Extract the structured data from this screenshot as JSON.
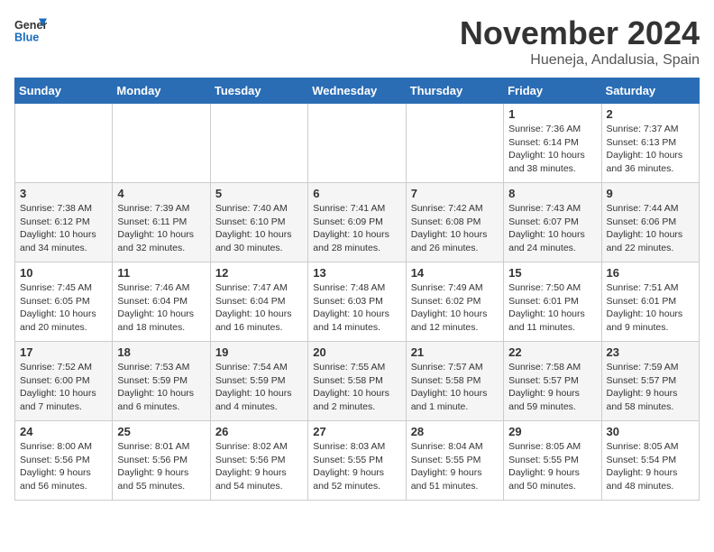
{
  "logo": {
    "line1": "General",
    "line2": "Blue"
  },
  "title": "November 2024",
  "location": "Hueneja, Andalusia, Spain",
  "weekdays": [
    "Sunday",
    "Monday",
    "Tuesday",
    "Wednesday",
    "Thursday",
    "Friday",
    "Saturday"
  ],
  "weeks": [
    [
      null,
      null,
      null,
      null,
      null,
      {
        "day": "1",
        "sunrise": "Sunrise: 7:36 AM",
        "sunset": "Sunset: 6:14 PM",
        "daylight": "Daylight: 10 hours and 38 minutes."
      },
      {
        "day": "2",
        "sunrise": "Sunrise: 7:37 AM",
        "sunset": "Sunset: 6:13 PM",
        "daylight": "Daylight: 10 hours and 36 minutes."
      }
    ],
    [
      {
        "day": "3",
        "sunrise": "Sunrise: 7:38 AM",
        "sunset": "Sunset: 6:12 PM",
        "daylight": "Daylight: 10 hours and 34 minutes."
      },
      {
        "day": "4",
        "sunrise": "Sunrise: 7:39 AM",
        "sunset": "Sunset: 6:11 PM",
        "daylight": "Daylight: 10 hours and 32 minutes."
      },
      {
        "day": "5",
        "sunrise": "Sunrise: 7:40 AM",
        "sunset": "Sunset: 6:10 PM",
        "daylight": "Daylight: 10 hours and 30 minutes."
      },
      {
        "day": "6",
        "sunrise": "Sunrise: 7:41 AM",
        "sunset": "Sunset: 6:09 PM",
        "daylight": "Daylight: 10 hours and 28 minutes."
      },
      {
        "day": "7",
        "sunrise": "Sunrise: 7:42 AM",
        "sunset": "Sunset: 6:08 PM",
        "daylight": "Daylight: 10 hours and 26 minutes."
      },
      {
        "day": "8",
        "sunrise": "Sunrise: 7:43 AM",
        "sunset": "Sunset: 6:07 PM",
        "daylight": "Daylight: 10 hours and 24 minutes."
      },
      {
        "day": "9",
        "sunrise": "Sunrise: 7:44 AM",
        "sunset": "Sunset: 6:06 PM",
        "daylight": "Daylight: 10 hours and 22 minutes."
      }
    ],
    [
      {
        "day": "10",
        "sunrise": "Sunrise: 7:45 AM",
        "sunset": "Sunset: 6:05 PM",
        "daylight": "Daylight: 10 hours and 20 minutes."
      },
      {
        "day": "11",
        "sunrise": "Sunrise: 7:46 AM",
        "sunset": "Sunset: 6:04 PM",
        "daylight": "Daylight: 10 hours and 18 minutes."
      },
      {
        "day": "12",
        "sunrise": "Sunrise: 7:47 AM",
        "sunset": "Sunset: 6:04 PM",
        "daylight": "Daylight: 10 hours and 16 minutes."
      },
      {
        "day": "13",
        "sunrise": "Sunrise: 7:48 AM",
        "sunset": "Sunset: 6:03 PM",
        "daylight": "Daylight: 10 hours and 14 minutes."
      },
      {
        "day": "14",
        "sunrise": "Sunrise: 7:49 AM",
        "sunset": "Sunset: 6:02 PM",
        "daylight": "Daylight: 10 hours and 12 minutes."
      },
      {
        "day": "15",
        "sunrise": "Sunrise: 7:50 AM",
        "sunset": "Sunset: 6:01 PM",
        "daylight": "Daylight: 10 hours and 11 minutes."
      },
      {
        "day": "16",
        "sunrise": "Sunrise: 7:51 AM",
        "sunset": "Sunset: 6:01 PM",
        "daylight": "Daylight: 10 hours and 9 minutes."
      }
    ],
    [
      {
        "day": "17",
        "sunrise": "Sunrise: 7:52 AM",
        "sunset": "Sunset: 6:00 PM",
        "daylight": "Daylight: 10 hours and 7 minutes."
      },
      {
        "day": "18",
        "sunrise": "Sunrise: 7:53 AM",
        "sunset": "Sunset: 5:59 PM",
        "daylight": "Daylight: 10 hours and 6 minutes."
      },
      {
        "day": "19",
        "sunrise": "Sunrise: 7:54 AM",
        "sunset": "Sunset: 5:59 PM",
        "daylight": "Daylight: 10 hours and 4 minutes."
      },
      {
        "day": "20",
        "sunrise": "Sunrise: 7:55 AM",
        "sunset": "Sunset: 5:58 PM",
        "daylight": "Daylight: 10 hours and 2 minutes."
      },
      {
        "day": "21",
        "sunrise": "Sunrise: 7:57 AM",
        "sunset": "Sunset: 5:58 PM",
        "daylight": "Daylight: 10 hours and 1 minute."
      },
      {
        "day": "22",
        "sunrise": "Sunrise: 7:58 AM",
        "sunset": "Sunset: 5:57 PM",
        "daylight": "Daylight: 9 hours and 59 minutes."
      },
      {
        "day": "23",
        "sunrise": "Sunrise: 7:59 AM",
        "sunset": "Sunset: 5:57 PM",
        "daylight": "Daylight: 9 hours and 58 minutes."
      }
    ],
    [
      {
        "day": "24",
        "sunrise": "Sunrise: 8:00 AM",
        "sunset": "Sunset: 5:56 PM",
        "daylight": "Daylight: 9 hours and 56 minutes."
      },
      {
        "day": "25",
        "sunrise": "Sunrise: 8:01 AM",
        "sunset": "Sunset: 5:56 PM",
        "daylight": "Daylight: 9 hours and 55 minutes."
      },
      {
        "day": "26",
        "sunrise": "Sunrise: 8:02 AM",
        "sunset": "Sunset: 5:56 PM",
        "daylight": "Daylight: 9 hours and 54 minutes."
      },
      {
        "day": "27",
        "sunrise": "Sunrise: 8:03 AM",
        "sunset": "Sunset: 5:55 PM",
        "daylight": "Daylight: 9 hours and 52 minutes."
      },
      {
        "day": "28",
        "sunrise": "Sunrise: 8:04 AM",
        "sunset": "Sunset: 5:55 PM",
        "daylight": "Daylight: 9 hours and 51 minutes."
      },
      {
        "day": "29",
        "sunrise": "Sunrise: 8:05 AM",
        "sunset": "Sunset: 5:55 PM",
        "daylight": "Daylight: 9 hours and 50 minutes."
      },
      {
        "day": "30",
        "sunrise": "Sunrise: 8:05 AM",
        "sunset": "Sunset: 5:54 PM",
        "daylight": "Daylight: 9 hours and 48 minutes."
      }
    ]
  ]
}
